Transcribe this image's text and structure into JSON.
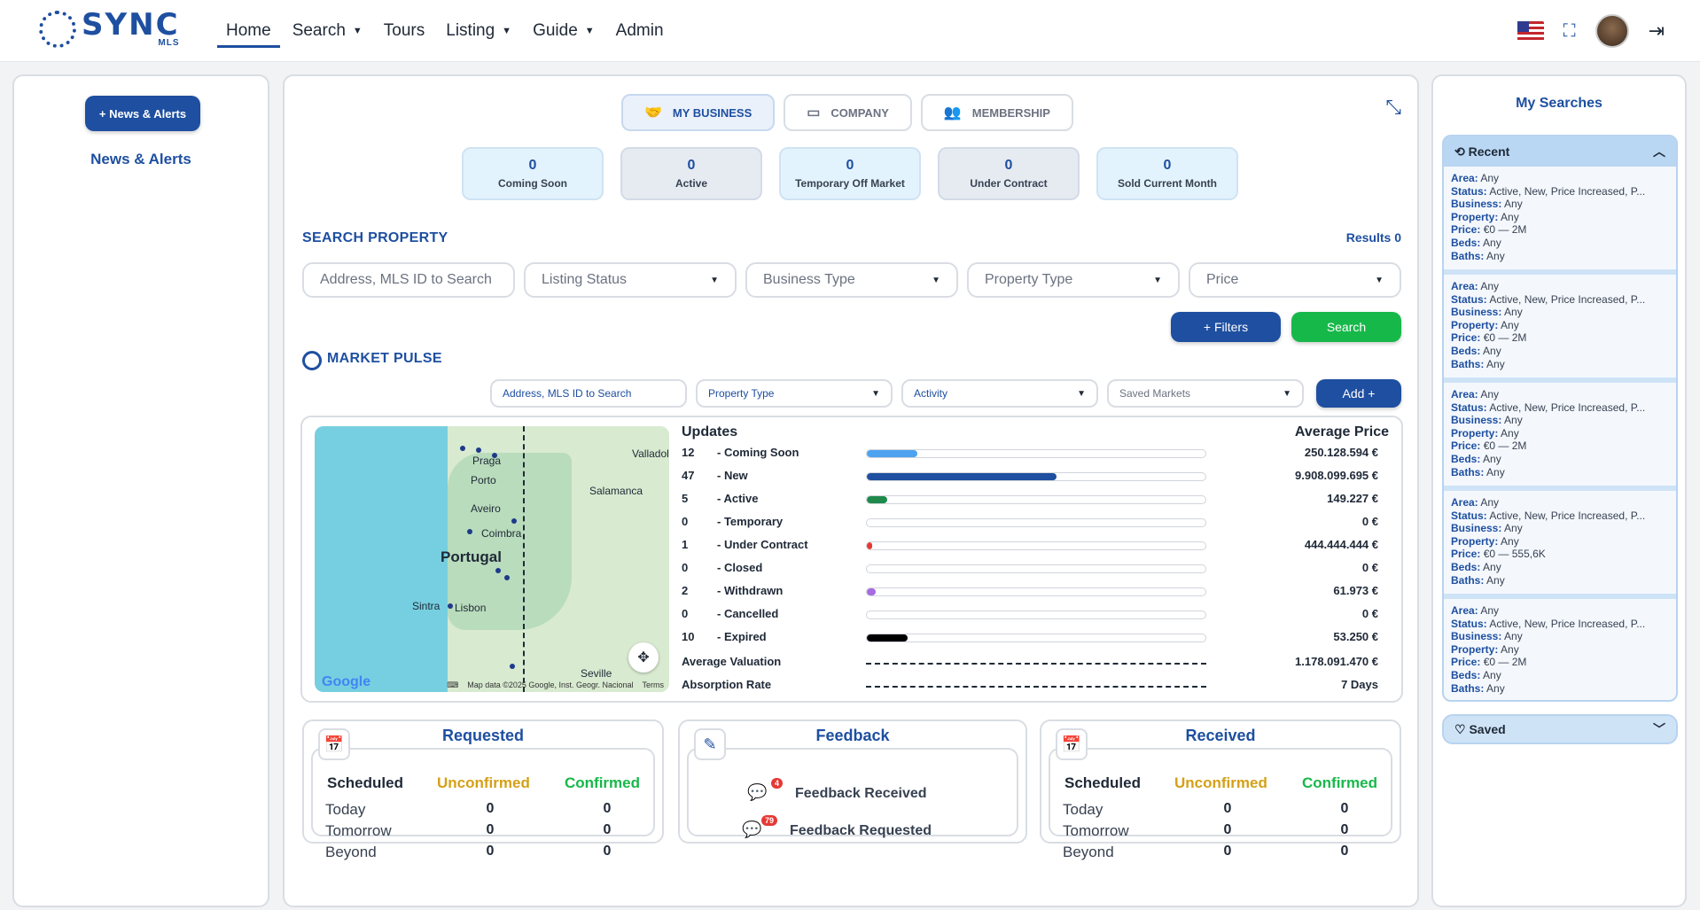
{
  "nav": {
    "logo_main": "SYNC",
    "logo_sub": "MLS",
    "items": [
      {
        "label": "Home",
        "caret": false,
        "active": true
      },
      {
        "label": "Search",
        "caret": true
      },
      {
        "label": "Tours",
        "caret": false
      },
      {
        "label": "Listing",
        "caret": true
      },
      {
        "label": "Guide",
        "caret": true
      },
      {
        "label": "Admin",
        "caret": false
      }
    ]
  },
  "left": {
    "button": "+ News & Alerts",
    "title": "News & Alerts"
  },
  "tabs": [
    {
      "label": "MY BUSINESS",
      "icon": "handshake-icon"
    },
    {
      "label": "COMPANY",
      "icon": "archive-icon"
    },
    {
      "label": "MEMBERSHIP",
      "icon": "users-icon"
    }
  ],
  "stats": [
    {
      "value": "0",
      "label": "Coming Soon"
    },
    {
      "value": "0",
      "label": "Active"
    },
    {
      "value": "0",
      "label": "Temporary Off Market"
    },
    {
      "value": "0",
      "label": "Under Contract"
    },
    {
      "value": "0",
      "label": "Sold Current Month"
    }
  ],
  "search": {
    "title": "SEARCH PROPERTY",
    "results": "Results 0",
    "address_placeholder": "Address, MLS ID to Search",
    "listing_status": "Listing Status",
    "business_type": "Business Type",
    "property_type": "Property Type",
    "price": "Price",
    "filters_button": "+ Filters",
    "search_button": "Search"
  },
  "pulse": {
    "title": "MARKET PULSE",
    "address_placeholder": "Address, MLS ID to Search",
    "property_type": "Property Type",
    "activity": "Activity",
    "saved_markets": "Saved Markets",
    "add_button": "Add +",
    "updates_label": "Updates",
    "avg_price_label": "Average Price",
    "rows": [
      {
        "count": "12",
        "label": "- Coming Soon",
        "price": "250.128.594 €",
        "fill": 0.15,
        "color": "#4da3f0"
      },
      {
        "count": "47",
        "label": "- New",
        "price": "9.908.099.695 €",
        "fill": 0.56,
        "color": "#1e4fa0"
      },
      {
        "count": "5",
        "label": "- Active",
        "price": "149.227 €",
        "fill": 0.06,
        "color": "#1f8a4c"
      },
      {
        "count": "0",
        "label": "- Temporary",
        "price": "0 €",
        "fill": 0,
        "color": "#999999"
      },
      {
        "count": "1",
        "label": "- Under Contract",
        "price": "444.444.444 €",
        "fill": 0.015,
        "color": "#e53935"
      },
      {
        "count": "0",
        "label": "- Closed",
        "price": "0 €",
        "fill": 0,
        "color": "#999999"
      },
      {
        "count": "2",
        "label": "- Withdrawn",
        "price": "61.973 €",
        "fill": 0.025,
        "color": "#a66be0"
      },
      {
        "count": "0",
        "label": "- Cancelled",
        "price": "0 €",
        "fill": 0,
        "color": "#999999"
      },
      {
        "count": "10",
        "label": "- Expired",
        "price": "53.250 €",
        "fill": 0.12,
        "color": "#000000"
      }
    ],
    "avg_valuation_label": "Average Valuation",
    "avg_valuation": "1.178.091.470 €",
    "absorption_label": "Absorption Rate",
    "absorption": "7 Days",
    "map": {
      "labels": [
        "Valladolid",
        "Praga",
        "Porto",
        "Salamanca",
        "Aveiro",
        "Coimbra",
        "Portugal",
        "Sintra",
        "Lisbon",
        "Seville"
      ],
      "footer_data": "Map data ©2025 Google, Inst. Geogr. Nacional",
      "footer_terms": "Terms",
      "google": "Google"
    }
  },
  "requested": {
    "title": "Requested",
    "headers": [
      "Scheduled",
      "Unconfirmed",
      "Confirmed"
    ],
    "rows": [
      {
        "label": "Today",
        "unconfirmed": "0",
        "confirmed": "0"
      },
      {
        "label": "Tomorrow",
        "unconfirmed": "0",
        "confirmed": "0"
      },
      {
        "label": "Beyond",
        "unconfirmed": "0",
        "confirmed": "0"
      }
    ]
  },
  "feedback": {
    "title": "Feedback",
    "received_label": "Feedback Received",
    "received_badge": "4",
    "requested_label": "Feedback Requested",
    "requested_badge": "79"
  },
  "received": {
    "title": "Received",
    "headers": [
      "Scheduled",
      "Unconfirmed",
      "Confirmed"
    ],
    "rows": [
      {
        "label": "Today",
        "unconfirmed": "0",
        "confirmed": "0"
      },
      {
        "label": "Tomorrow",
        "unconfirmed": "0",
        "confirmed": "0"
      },
      {
        "label": "Beyond",
        "unconfirmed": "0",
        "confirmed": "0"
      }
    ]
  },
  "searches": {
    "title": "My Searches",
    "recent_label": "Recent",
    "saved_label": "Saved",
    "items": [
      {
        "area": "Any",
        "status": "Active, New, Price Increased, P...",
        "business": "Any",
        "property": "Any",
        "price": "€0 — 2M",
        "beds": "Any",
        "baths": "Any"
      },
      {
        "area": "Any",
        "status": "Active, New, Price Increased, P...",
        "business": "Any",
        "property": "Any",
        "price": "€0 — 2M",
        "beds": "Any",
        "baths": "Any"
      },
      {
        "area": "Any",
        "status": "Active, New, Price Increased, P...",
        "business": "Any",
        "property": "Any",
        "price": "€0 — 2M",
        "beds": "Any",
        "baths": "Any"
      },
      {
        "area": "Any",
        "status": "Active, New, Price Increased, P...",
        "business": "Any",
        "property": "Any",
        "price": "€0 — 555,6K",
        "beds": "Any",
        "baths": "Any"
      },
      {
        "area": "Any",
        "status": "Active, New, Price Increased, P...",
        "business": "Any",
        "property": "Any",
        "price": "€0 — 2M",
        "beds": "Any",
        "baths": "Any"
      }
    ]
  },
  "colors": {
    "brand": "#1e4fa0",
    "green": "#17b84a",
    "unconfirmed": "#d4a017",
    "confirmed": "#17b84a"
  }
}
